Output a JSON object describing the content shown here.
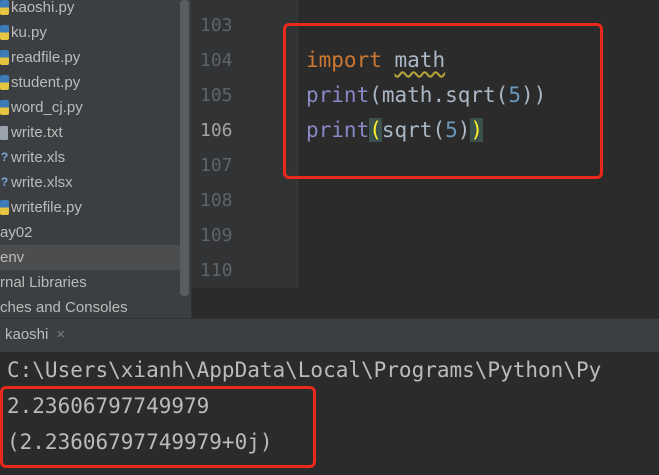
{
  "sidebar": {
    "items": [
      {
        "label": "kaoshi.py",
        "icon": "python-file-icon"
      },
      {
        "label": "ku.py",
        "icon": "python-file-icon"
      },
      {
        "label": "readfile.py",
        "icon": "python-file-icon"
      },
      {
        "label": "student.py",
        "icon": "python-file-icon"
      },
      {
        "label": "word_cj.py",
        "icon": "python-file-icon"
      },
      {
        "label": "write.txt",
        "icon": "text-file-icon"
      },
      {
        "label": "write.xls",
        "icon": "unknown-file-icon"
      },
      {
        "label": "write.xlsx",
        "icon": "unknown-file-icon"
      },
      {
        "label": "writefile.py",
        "icon": "python-file-icon"
      },
      {
        "label": "ay02",
        "icon": ""
      },
      {
        "label": "env",
        "icon": ""
      },
      {
        "label": "rnal Libraries",
        "icon": ""
      },
      {
        "label": "ches and Consoles",
        "icon": ""
      }
    ]
  },
  "editor": {
    "line_numbers": [
      "103",
      "104",
      "105",
      "106",
      "107",
      "108",
      "109",
      "110"
    ],
    "current_line": "106",
    "code": {
      "l1": {
        "kw": "import",
        "sp": " ",
        "mod": "math"
      },
      "l2": {
        "fn": "print",
        "p1": "(",
        "call": "math.sqrt(",
        "num": "5",
        "p2": "))"
      },
      "l3": {
        "fn": "print",
        "p1": "(",
        "call": "sqrt(",
        "num": "5",
        "p2": ")",
        "p3": ")"
      }
    }
  },
  "run": {
    "tab_label": "kaoshi",
    "close_glyph": "×",
    "console": [
      "C:\\Users\\xianh\\AppData\\Local\\Programs\\Python\\Py",
      "2.23606797749979",
      "(2.23606797749979+0j)"
    ]
  },
  "colors": {
    "highlight_box": "#e8291c",
    "keyword": "#cc7832",
    "builtin": "#8888c6",
    "number": "#6897bb"
  }
}
